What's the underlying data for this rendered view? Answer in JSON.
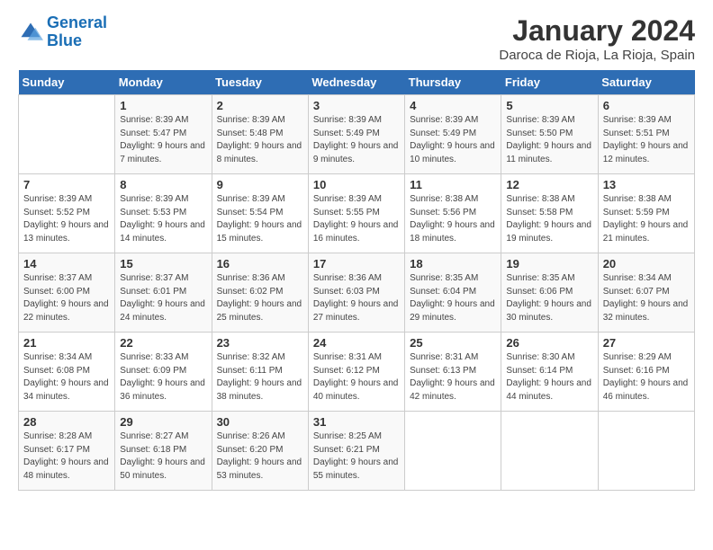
{
  "header": {
    "logo_line1": "General",
    "logo_line2": "Blue",
    "month": "January 2024",
    "location": "Daroca de Rioja, La Rioja, Spain"
  },
  "weekdays": [
    "Sunday",
    "Monday",
    "Tuesday",
    "Wednesday",
    "Thursday",
    "Friday",
    "Saturday"
  ],
  "weeks": [
    [
      {
        "day": "",
        "sunrise": "",
        "sunset": "",
        "daylight": ""
      },
      {
        "day": "1",
        "sunrise": "Sunrise: 8:39 AM",
        "sunset": "Sunset: 5:47 PM",
        "daylight": "Daylight: 9 hours and 7 minutes."
      },
      {
        "day": "2",
        "sunrise": "Sunrise: 8:39 AM",
        "sunset": "Sunset: 5:48 PM",
        "daylight": "Daylight: 9 hours and 8 minutes."
      },
      {
        "day": "3",
        "sunrise": "Sunrise: 8:39 AM",
        "sunset": "Sunset: 5:49 PM",
        "daylight": "Daylight: 9 hours and 9 minutes."
      },
      {
        "day": "4",
        "sunrise": "Sunrise: 8:39 AM",
        "sunset": "Sunset: 5:49 PM",
        "daylight": "Daylight: 9 hours and 10 minutes."
      },
      {
        "day": "5",
        "sunrise": "Sunrise: 8:39 AM",
        "sunset": "Sunset: 5:50 PM",
        "daylight": "Daylight: 9 hours and 11 minutes."
      },
      {
        "day": "6",
        "sunrise": "Sunrise: 8:39 AM",
        "sunset": "Sunset: 5:51 PM",
        "daylight": "Daylight: 9 hours and 12 minutes."
      }
    ],
    [
      {
        "day": "7",
        "sunrise": "Sunrise: 8:39 AM",
        "sunset": "Sunset: 5:52 PM",
        "daylight": "Daylight: 9 hours and 13 minutes."
      },
      {
        "day": "8",
        "sunrise": "Sunrise: 8:39 AM",
        "sunset": "Sunset: 5:53 PM",
        "daylight": "Daylight: 9 hours and 14 minutes."
      },
      {
        "day": "9",
        "sunrise": "Sunrise: 8:39 AM",
        "sunset": "Sunset: 5:54 PM",
        "daylight": "Daylight: 9 hours and 15 minutes."
      },
      {
        "day": "10",
        "sunrise": "Sunrise: 8:39 AM",
        "sunset": "Sunset: 5:55 PM",
        "daylight": "Daylight: 9 hours and 16 minutes."
      },
      {
        "day": "11",
        "sunrise": "Sunrise: 8:38 AM",
        "sunset": "Sunset: 5:56 PM",
        "daylight": "Daylight: 9 hours and 18 minutes."
      },
      {
        "day": "12",
        "sunrise": "Sunrise: 8:38 AM",
        "sunset": "Sunset: 5:58 PM",
        "daylight": "Daylight: 9 hours and 19 minutes."
      },
      {
        "day": "13",
        "sunrise": "Sunrise: 8:38 AM",
        "sunset": "Sunset: 5:59 PM",
        "daylight": "Daylight: 9 hours and 21 minutes."
      }
    ],
    [
      {
        "day": "14",
        "sunrise": "Sunrise: 8:37 AM",
        "sunset": "Sunset: 6:00 PM",
        "daylight": "Daylight: 9 hours and 22 minutes."
      },
      {
        "day": "15",
        "sunrise": "Sunrise: 8:37 AM",
        "sunset": "Sunset: 6:01 PM",
        "daylight": "Daylight: 9 hours and 24 minutes."
      },
      {
        "day": "16",
        "sunrise": "Sunrise: 8:36 AM",
        "sunset": "Sunset: 6:02 PM",
        "daylight": "Daylight: 9 hours and 25 minutes."
      },
      {
        "day": "17",
        "sunrise": "Sunrise: 8:36 AM",
        "sunset": "Sunset: 6:03 PM",
        "daylight": "Daylight: 9 hours and 27 minutes."
      },
      {
        "day": "18",
        "sunrise": "Sunrise: 8:35 AM",
        "sunset": "Sunset: 6:04 PM",
        "daylight": "Daylight: 9 hours and 29 minutes."
      },
      {
        "day": "19",
        "sunrise": "Sunrise: 8:35 AM",
        "sunset": "Sunset: 6:06 PM",
        "daylight": "Daylight: 9 hours and 30 minutes."
      },
      {
        "day": "20",
        "sunrise": "Sunrise: 8:34 AM",
        "sunset": "Sunset: 6:07 PM",
        "daylight": "Daylight: 9 hours and 32 minutes."
      }
    ],
    [
      {
        "day": "21",
        "sunrise": "Sunrise: 8:34 AM",
        "sunset": "Sunset: 6:08 PM",
        "daylight": "Daylight: 9 hours and 34 minutes."
      },
      {
        "day": "22",
        "sunrise": "Sunrise: 8:33 AM",
        "sunset": "Sunset: 6:09 PM",
        "daylight": "Daylight: 9 hours and 36 minutes."
      },
      {
        "day": "23",
        "sunrise": "Sunrise: 8:32 AM",
        "sunset": "Sunset: 6:11 PM",
        "daylight": "Daylight: 9 hours and 38 minutes."
      },
      {
        "day": "24",
        "sunrise": "Sunrise: 8:31 AM",
        "sunset": "Sunset: 6:12 PM",
        "daylight": "Daylight: 9 hours and 40 minutes."
      },
      {
        "day": "25",
        "sunrise": "Sunrise: 8:31 AM",
        "sunset": "Sunset: 6:13 PM",
        "daylight": "Daylight: 9 hours and 42 minutes."
      },
      {
        "day": "26",
        "sunrise": "Sunrise: 8:30 AM",
        "sunset": "Sunset: 6:14 PM",
        "daylight": "Daylight: 9 hours and 44 minutes."
      },
      {
        "day": "27",
        "sunrise": "Sunrise: 8:29 AM",
        "sunset": "Sunset: 6:16 PM",
        "daylight": "Daylight: 9 hours and 46 minutes."
      }
    ],
    [
      {
        "day": "28",
        "sunrise": "Sunrise: 8:28 AM",
        "sunset": "Sunset: 6:17 PM",
        "daylight": "Daylight: 9 hours and 48 minutes."
      },
      {
        "day": "29",
        "sunrise": "Sunrise: 8:27 AM",
        "sunset": "Sunset: 6:18 PM",
        "daylight": "Daylight: 9 hours and 50 minutes."
      },
      {
        "day": "30",
        "sunrise": "Sunrise: 8:26 AM",
        "sunset": "Sunset: 6:20 PM",
        "daylight": "Daylight: 9 hours and 53 minutes."
      },
      {
        "day": "31",
        "sunrise": "Sunrise: 8:25 AM",
        "sunset": "Sunset: 6:21 PM",
        "daylight": "Daylight: 9 hours and 55 minutes."
      },
      {
        "day": "",
        "sunrise": "",
        "sunset": "",
        "daylight": ""
      },
      {
        "day": "",
        "sunrise": "",
        "sunset": "",
        "daylight": ""
      },
      {
        "day": "",
        "sunrise": "",
        "sunset": "",
        "daylight": ""
      }
    ]
  ]
}
